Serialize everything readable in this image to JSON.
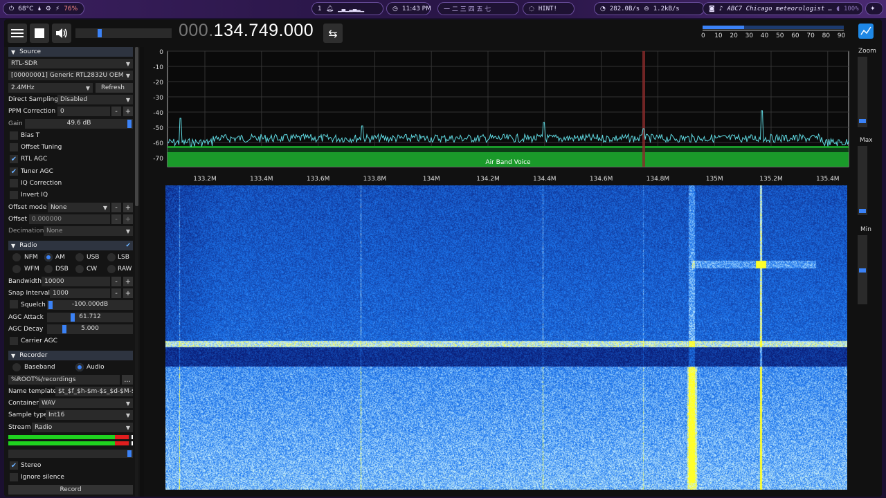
{
  "statusbar": {
    "temp": "68°C",
    "battery": "76%",
    "workspace": "1",
    "clock": "11:43 PM",
    "workspaces_glyphs": "一 二 三 四 五 七",
    "hint": "HINT!",
    "net_down": "282.0B/s",
    "net_up": "1.2kB/s",
    "media": "ABC7 Chicago meteorologist …",
    "volume": "100%"
  },
  "toolbar": {
    "freq_prefix": "000.",
    "freq_main": "134.749.000",
    "scale_ticks": [
      "0",
      "10",
      "20",
      "30",
      "40",
      "50",
      "60",
      "70",
      "80",
      "90"
    ]
  },
  "source": {
    "header": "Source",
    "device_type": "RTL-SDR",
    "device": "[00000001] Generic RTL2832U OEM",
    "sample_rate": "2.4MHz",
    "refresh": "Refresh",
    "direct_sampling_label": "Direct Sampling",
    "direct_sampling": "Disabled",
    "ppm_label": "PPM Correction",
    "ppm_value": "0",
    "gain_label": "Gain",
    "gain_value": "49.6 dB",
    "bias_t": "Bias T",
    "offset_tuning": "Offset Tuning",
    "rtl_agc": "RTL AGC",
    "tuner_agc": "Tuner AGC",
    "iq_correction": "IQ Correction",
    "invert_iq": "Invert IQ",
    "offset_mode_label": "Offset mode",
    "offset_mode": "None",
    "offset_label": "Offset",
    "offset_value": "0.000000",
    "decimation_label": "Decimation",
    "decimation": "None",
    "minus": "-",
    "plus": "+"
  },
  "radio": {
    "header": "Radio",
    "modes": [
      "NFM",
      "AM",
      "USB",
      "LSB",
      "WFM",
      "DSB",
      "CW",
      "RAW"
    ],
    "selected_mode": "AM",
    "bandwidth_label": "Bandwidth",
    "bandwidth": "10000",
    "snap_label": "Snap Interval",
    "snap": "1000",
    "squelch_label": "Squelch",
    "squelch": "-100.000dB",
    "agc_attack_label": "AGC Attack",
    "agc_attack": "61.712",
    "agc_decay_label": "AGC Decay",
    "agc_decay": "5.000",
    "carrier_agc": "Carrier AGC"
  },
  "recorder": {
    "header": "Recorder",
    "baseband": "Baseband",
    "audio": "Audio",
    "path": "%ROOT%/recordings",
    "browse": "...",
    "name_template_label": "Name template",
    "name_template": "$t_$f_$h-$m-$s_$d-$M-$y",
    "container_label": "Container",
    "container": "WAV",
    "sample_type_label": "Sample type",
    "sample_type": "Int16",
    "stream_label": "Stream",
    "stream": "Radio",
    "stereo": "Stereo",
    "ignore_silence": "Ignore silence",
    "record": "Record"
  },
  "fft": {
    "db_ticks": [
      "0",
      "-10",
      "-20",
      "-30",
      "-40",
      "-50",
      "-60",
      "-70"
    ],
    "freq_ticks": [
      "133.2M",
      "133.4M",
      "133.6M",
      "133.8M",
      "134M",
      "134.2M",
      "134.4M",
      "134.6M",
      "134.8M",
      "135M",
      "135.2M",
      "135.4M"
    ],
    "band_label": "Air Band Voice",
    "band_color": "#1a9a2a",
    "trace_color": "#5fd8e0"
  },
  "right": {
    "zoom": "Zoom",
    "max": "Max",
    "min": "Min"
  }
}
